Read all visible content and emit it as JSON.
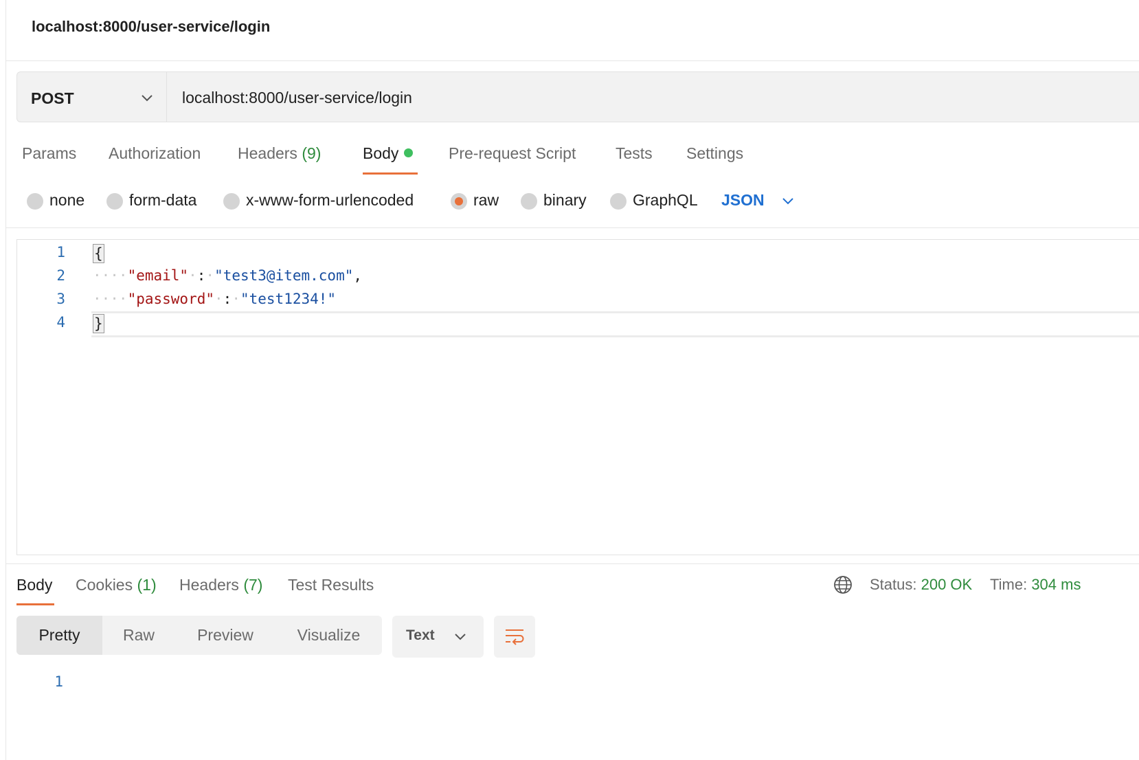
{
  "request_title": "localhost:8000/user-service/login",
  "request": {
    "method": "POST",
    "url": "localhost:8000/user-service/login"
  },
  "request_tabs": {
    "params": "Params",
    "authorization": "Authorization",
    "headers": "Headers",
    "headers_count": "(9)",
    "body": "Body",
    "pre_request": "Pre-request Script",
    "tests": "Tests",
    "settings": "Settings",
    "active": "Body"
  },
  "body_types": {
    "none": "none",
    "form_data": "form-data",
    "urlencoded": "x-www-form-urlencoded",
    "raw": "raw",
    "binary": "binary",
    "graphql": "GraphQL",
    "selected": "raw",
    "raw_format": "JSON"
  },
  "editor": {
    "lines": [
      {
        "num": "1",
        "open": "{"
      },
      {
        "num": "2",
        "indent": "····",
        "key": "\"email\"",
        "sep1": "·",
        "colon": ":",
        "sep2": "·",
        "value": "\"test3@item.com\"",
        "trail": ","
      },
      {
        "num": "3",
        "indent": "····",
        "key": "\"password\"",
        "sep1": "·",
        "colon": ":",
        "sep2": "·",
        "value": "\"test1234!\"",
        "trail": ""
      },
      {
        "num": "4",
        "close": "}"
      }
    ]
  },
  "response_tabs": {
    "body": "Body",
    "cookies": "Cookies",
    "cookies_count": "(1)",
    "headers": "Headers",
    "headers_count": "(7)",
    "test_results": "Test Results",
    "active": "Body"
  },
  "response_status": {
    "status_label": "Status:",
    "status_value": "200 OK",
    "time_label": "Time:",
    "time_value": "304 ms"
  },
  "response_view": {
    "modes": [
      "Pretty",
      "Raw",
      "Preview",
      "Visualize"
    ],
    "active": "Pretty",
    "format": "Text",
    "line_numbers": [
      "1"
    ]
  },
  "colors": {
    "accent": "#e8703a",
    "success": "#2e8b3c",
    "link": "#1f6fd1",
    "json_key": "#a31515",
    "json_string": "#1a4fa0"
  }
}
